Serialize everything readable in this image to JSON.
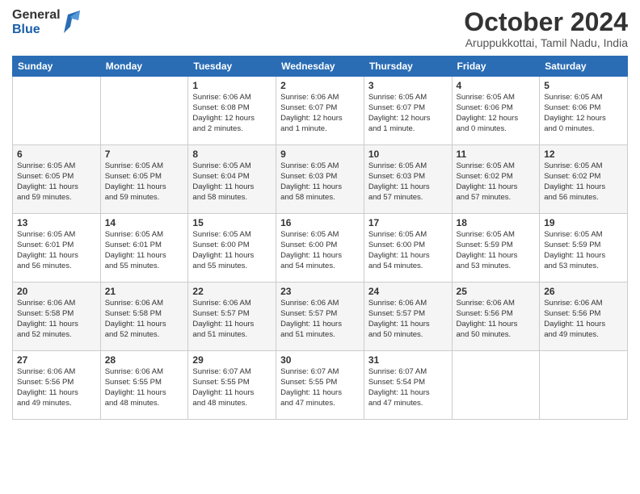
{
  "header": {
    "logo_general": "General",
    "logo_blue": "Blue",
    "month": "October 2024",
    "location": "Aruppukkottai, Tamil Nadu, India"
  },
  "weekdays": [
    "Sunday",
    "Monday",
    "Tuesday",
    "Wednesday",
    "Thursday",
    "Friday",
    "Saturday"
  ],
  "weeks": [
    [
      {
        "day": "",
        "info": ""
      },
      {
        "day": "",
        "info": ""
      },
      {
        "day": "1",
        "info": "Sunrise: 6:06 AM\nSunset: 6:08 PM\nDaylight: 12 hours\nand 2 minutes."
      },
      {
        "day": "2",
        "info": "Sunrise: 6:06 AM\nSunset: 6:07 PM\nDaylight: 12 hours\nand 1 minute."
      },
      {
        "day": "3",
        "info": "Sunrise: 6:05 AM\nSunset: 6:07 PM\nDaylight: 12 hours\nand 1 minute."
      },
      {
        "day": "4",
        "info": "Sunrise: 6:05 AM\nSunset: 6:06 PM\nDaylight: 12 hours\nand 0 minutes."
      },
      {
        "day": "5",
        "info": "Sunrise: 6:05 AM\nSunset: 6:06 PM\nDaylight: 12 hours\nand 0 minutes."
      }
    ],
    [
      {
        "day": "6",
        "info": "Sunrise: 6:05 AM\nSunset: 6:05 PM\nDaylight: 11 hours\nand 59 minutes."
      },
      {
        "day": "7",
        "info": "Sunrise: 6:05 AM\nSunset: 6:05 PM\nDaylight: 11 hours\nand 59 minutes."
      },
      {
        "day": "8",
        "info": "Sunrise: 6:05 AM\nSunset: 6:04 PM\nDaylight: 11 hours\nand 58 minutes."
      },
      {
        "day": "9",
        "info": "Sunrise: 6:05 AM\nSunset: 6:03 PM\nDaylight: 11 hours\nand 58 minutes."
      },
      {
        "day": "10",
        "info": "Sunrise: 6:05 AM\nSunset: 6:03 PM\nDaylight: 11 hours\nand 57 minutes."
      },
      {
        "day": "11",
        "info": "Sunrise: 6:05 AM\nSunset: 6:02 PM\nDaylight: 11 hours\nand 57 minutes."
      },
      {
        "day": "12",
        "info": "Sunrise: 6:05 AM\nSunset: 6:02 PM\nDaylight: 11 hours\nand 56 minutes."
      }
    ],
    [
      {
        "day": "13",
        "info": "Sunrise: 6:05 AM\nSunset: 6:01 PM\nDaylight: 11 hours\nand 56 minutes."
      },
      {
        "day": "14",
        "info": "Sunrise: 6:05 AM\nSunset: 6:01 PM\nDaylight: 11 hours\nand 55 minutes."
      },
      {
        "day": "15",
        "info": "Sunrise: 6:05 AM\nSunset: 6:00 PM\nDaylight: 11 hours\nand 55 minutes."
      },
      {
        "day": "16",
        "info": "Sunrise: 6:05 AM\nSunset: 6:00 PM\nDaylight: 11 hours\nand 54 minutes."
      },
      {
        "day": "17",
        "info": "Sunrise: 6:05 AM\nSunset: 6:00 PM\nDaylight: 11 hours\nand 54 minutes."
      },
      {
        "day": "18",
        "info": "Sunrise: 6:05 AM\nSunset: 5:59 PM\nDaylight: 11 hours\nand 53 minutes."
      },
      {
        "day": "19",
        "info": "Sunrise: 6:05 AM\nSunset: 5:59 PM\nDaylight: 11 hours\nand 53 minutes."
      }
    ],
    [
      {
        "day": "20",
        "info": "Sunrise: 6:06 AM\nSunset: 5:58 PM\nDaylight: 11 hours\nand 52 minutes."
      },
      {
        "day": "21",
        "info": "Sunrise: 6:06 AM\nSunset: 5:58 PM\nDaylight: 11 hours\nand 52 minutes."
      },
      {
        "day": "22",
        "info": "Sunrise: 6:06 AM\nSunset: 5:57 PM\nDaylight: 11 hours\nand 51 minutes."
      },
      {
        "day": "23",
        "info": "Sunrise: 6:06 AM\nSunset: 5:57 PM\nDaylight: 11 hours\nand 51 minutes."
      },
      {
        "day": "24",
        "info": "Sunrise: 6:06 AM\nSunset: 5:57 PM\nDaylight: 11 hours\nand 50 minutes."
      },
      {
        "day": "25",
        "info": "Sunrise: 6:06 AM\nSunset: 5:56 PM\nDaylight: 11 hours\nand 50 minutes."
      },
      {
        "day": "26",
        "info": "Sunrise: 6:06 AM\nSunset: 5:56 PM\nDaylight: 11 hours\nand 49 minutes."
      }
    ],
    [
      {
        "day": "27",
        "info": "Sunrise: 6:06 AM\nSunset: 5:56 PM\nDaylight: 11 hours\nand 49 minutes."
      },
      {
        "day": "28",
        "info": "Sunrise: 6:06 AM\nSunset: 5:55 PM\nDaylight: 11 hours\nand 48 minutes."
      },
      {
        "day": "29",
        "info": "Sunrise: 6:07 AM\nSunset: 5:55 PM\nDaylight: 11 hours\nand 48 minutes."
      },
      {
        "day": "30",
        "info": "Sunrise: 6:07 AM\nSunset: 5:55 PM\nDaylight: 11 hours\nand 47 minutes."
      },
      {
        "day": "31",
        "info": "Sunrise: 6:07 AM\nSunset: 5:54 PM\nDaylight: 11 hours\nand 47 minutes."
      },
      {
        "day": "",
        "info": ""
      },
      {
        "day": "",
        "info": ""
      }
    ]
  ]
}
